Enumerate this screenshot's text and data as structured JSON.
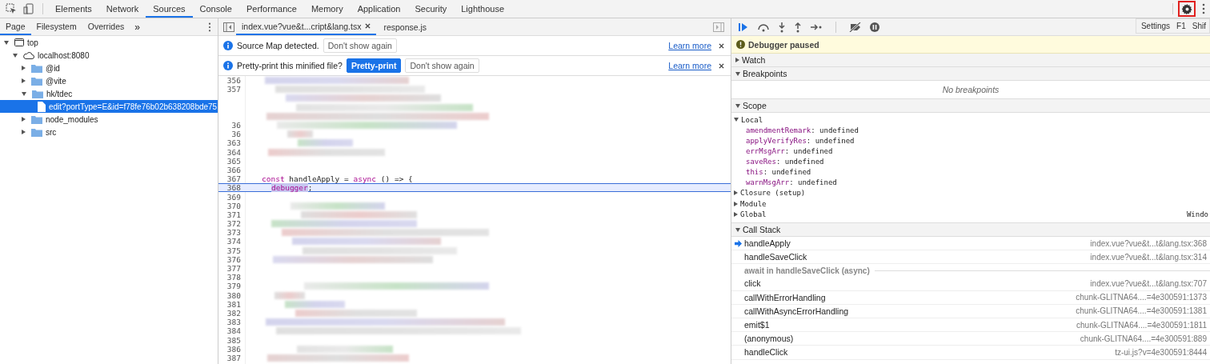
{
  "main_tabs": [
    {
      "label": "Elements",
      "selected": false
    },
    {
      "label": "Network",
      "selected": false
    },
    {
      "label": "Sources",
      "selected": true
    },
    {
      "label": "Console",
      "selected": false
    },
    {
      "label": "Performance",
      "selected": false
    },
    {
      "label": "Memory",
      "selected": false
    },
    {
      "label": "Application",
      "selected": false
    },
    {
      "label": "Security",
      "selected": false
    },
    {
      "label": "Lighthouse",
      "selected": false
    }
  ],
  "settings_highlighted": true,
  "tooltip": {
    "label": "Settings",
    "shortcuts": [
      "F1",
      "Shif"
    ]
  },
  "navigator": {
    "tabs": [
      {
        "label": "Page",
        "selected": true
      },
      {
        "label": "Filesystem",
        "selected": false
      },
      {
        "label": "Overrides",
        "selected": false
      }
    ],
    "more": "»",
    "tree": [
      {
        "label": "top",
        "kind": "frame",
        "expanded": true,
        "children": [
          {
            "label": "localhost:8080",
            "kind": "origin",
            "expanded": true,
            "children": [
              {
                "label": "@id",
                "kind": "folder",
                "expanded": false
              },
              {
                "label": "@vite",
                "kind": "folder",
                "expanded": false
              },
              {
                "label": "hk/tdec",
                "kind": "folder",
                "expanded": true,
                "children": [
                  {
                    "label": "edit?portType=E&id=f78fe76b02b638208bde75",
                    "kind": "file",
                    "selected": true
                  }
                ]
              },
              {
                "label": "node_modules",
                "kind": "folder",
                "expanded": false
              },
              {
                "label": "src",
                "kind": "folder",
                "expanded": false
              }
            ]
          }
        ]
      }
    ]
  },
  "editor": {
    "tabs": [
      {
        "label": "index.vue?vue&t...cript&lang.tsx",
        "selected": true,
        "closable": true
      },
      {
        "label": "response.js",
        "selected": false,
        "closable": false
      }
    ],
    "infobars": [
      {
        "message": "Source Map detected.",
        "buttons": [
          {
            "label": "Don't show again",
            "primary": false
          }
        ],
        "link": "Learn more"
      },
      {
        "message": "Pretty-print this minified file?",
        "buttons": [
          {
            "label": "Pretty-print",
            "primary": true
          },
          {
            "label": "Don't show again",
            "primary": false
          }
        ],
        "link": "Learn more"
      }
    ],
    "lines": [
      {
        "number": "356",
        "kind": "blurred"
      },
      {
        "number": "357",
        "kind": "blurred"
      },
      {
        "kind": "blurred"
      },
      {
        "kind": "blurred"
      },
      {
        "kind": "blurred"
      },
      {
        "number": "36",
        "kind": "blurred"
      },
      {
        "number": "36",
        "kind": "blurred"
      },
      {
        "number": "363",
        "kind": "blurred"
      },
      {
        "number": "364",
        "kind": "blurred"
      },
      {
        "number": "365",
        "kind": "empty"
      },
      {
        "number": "366",
        "kind": "empty"
      },
      {
        "number": "367",
        "kind": "code",
        "paused": false,
        "indented": false,
        "tokens": [
          {
            "text": "const",
            "keyword": true,
            "highlighted": false
          },
          {
            "text": "handleApply =",
            "keyword": false,
            "highlighted": false
          },
          {
            "text": "async",
            "keyword": true,
            "highlighted": false
          },
          {
            "text": "() => {",
            "keyword": false,
            "highlighted": false
          }
        ]
      },
      {
        "number": "368",
        "kind": "code",
        "paused": true,
        "indented": true,
        "tokens": [
          {
            "text": "debugger",
            "keyword": true,
            "highlighted": true
          },
          {
            "text": ";",
            "keyword": false,
            "highlighted": false
          }
        ]
      },
      {
        "number": "369",
        "kind": "empty"
      },
      {
        "number": "370",
        "kind": "blurred"
      },
      {
        "number": "371",
        "kind": "blurred"
      },
      {
        "number": "372",
        "kind": "blurred"
      },
      {
        "number": "373",
        "kind": "blurred"
      },
      {
        "number": "374",
        "kind": "blurred"
      },
      {
        "number": "375",
        "kind": "blurred"
      },
      {
        "number": "376",
        "kind": "blurred"
      },
      {
        "number": "377",
        "kind": "empty"
      },
      {
        "number": "378",
        "kind": "empty"
      },
      {
        "number": "379",
        "kind": "blurred"
      },
      {
        "number": "380",
        "kind": "blurred"
      },
      {
        "number": "381",
        "kind": "blurred"
      },
      {
        "number": "382",
        "kind": "blurred"
      },
      {
        "number": "383",
        "kind": "blurred"
      },
      {
        "number": "384",
        "kind": "blurred"
      },
      {
        "number": "385",
        "kind": "empty"
      },
      {
        "number": "386",
        "kind": "blurred"
      },
      {
        "number": "387",
        "kind": "blurred"
      }
    ]
  },
  "debugger": {
    "banner": "Debugger paused",
    "sections": [
      {
        "title": "Watch",
        "expanded": false
      },
      {
        "title": "Breakpoints",
        "expanded": true,
        "empty_text": "No breakpoints"
      }
    ],
    "scope": {
      "title": "Scope",
      "expanded": true,
      "groups": [
        {
          "label": "Local",
          "expanded": true,
          "vars": [
            {
              "name": "amendmentRemark",
              "value": ": undefined"
            },
            {
              "name": "applyVerifyRes",
              "value": ": undefined"
            },
            {
              "name": "errMsgArr",
              "value": ": undefined"
            },
            {
              "name": "saveRes",
              "value": ": undefined"
            },
            {
              "name": "this",
              "value": ": undefined"
            },
            {
              "name": "warnMsgArr",
              "value": ": undefined"
            }
          ]
        },
        {
          "label": "Closure (setup)",
          "expanded": false
        },
        {
          "label": "Module",
          "expanded": false
        },
        {
          "label": "Global",
          "expanded": false,
          "value": "Windo"
        }
      ]
    },
    "call_stack": {
      "title": "Call Stack",
      "expanded": true,
      "frames": [
        {
          "kind": "frame",
          "name": "handleApply",
          "location": "index.vue?vue&t...t&lang.tsx:368",
          "current": true
        },
        {
          "kind": "frame",
          "name": "handleSaveClick",
          "location": "index.vue?vue&t...t&lang.tsx:314",
          "current": false
        },
        {
          "kind": "async",
          "name": "await in handleSaveClick (async)"
        },
        {
          "kind": "frame",
          "name": "click",
          "location": "index.vue?vue&t...t&lang.tsx:707",
          "current": false
        },
        {
          "kind": "frame",
          "name": "callWithErrorHandling",
          "location": "chunk-GLITNA64....=4e300591:1373",
          "current": false
        },
        {
          "kind": "frame",
          "name": "callWithAsyncErrorHandling",
          "location": "chunk-GLITNA64....=4e300591:1381",
          "current": false
        },
        {
          "kind": "frame",
          "name": "emit$1",
          "location": "chunk-GLITNA64....=4e300591:1811",
          "current": false
        },
        {
          "kind": "frame",
          "name": "(anonymous)",
          "location": "chunk-GLITNA64....=4e300591:889",
          "current": false
        },
        {
          "kind": "frame",
          "name": "handleClick",
          "location": "tz-ui.js?v=4e300591:8444",
          "current": false
        }
      ]
    }
  }
}
